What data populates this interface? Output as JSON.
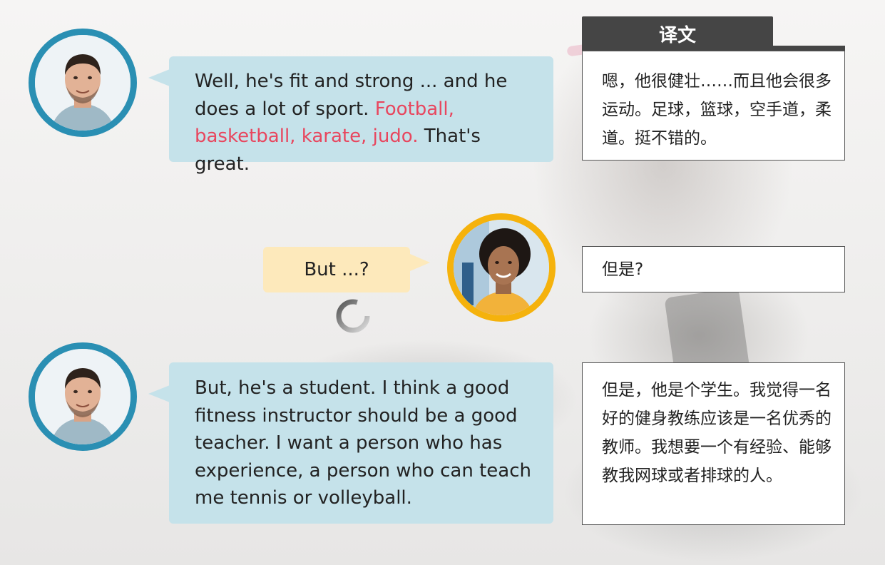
{
  "translation_panel": {
    "header": "译文"
  },
  "dialogue": [
    {
      "speaker": "man",
      "text_before": "Well, he's fit and strong ... and he does a lot of sport. ",
      "highlight": "Football, basketball, karate, judo.",
      "text_after": " That's great.",
      "translation": "嗯，他很健壮……而且他会很多运动。足球，篮球，空手道，柔道。挺不错的。"
    },
    {
      "speaker": "woman",
      "text": "But ...?",
      "translation": "但是?"
    },
    {
      "speaker": "man",
      "text": "But, he's a student. I think a good fitness instructor should be a good teacher. I want a person who has experience, a person who can teach me tennis or volleyball.",
      "translation": "但是，他是个学生。我觉得一名好的健身教练应该是一名优秀的教师。我想要一个有经验、能够教我网球或者排球的人。"
    }
  ],
  "icons": {
    "man_avatar": "man-avatar-icon",
    "woman_avatar": "woman-avatar-icon",
    "spinner": "loading-spinner-icon"
  },
  "colors": {
    "man_ring": "#2a8fb3",
    "woman_ring": "#f5b20c",
    "man_bubble": "#c5e2ea",
    "woman_bubble": "#fde9bb",
    "highlight_text": "#e8465e",
    "translation_header": "#454545"
  }
}
